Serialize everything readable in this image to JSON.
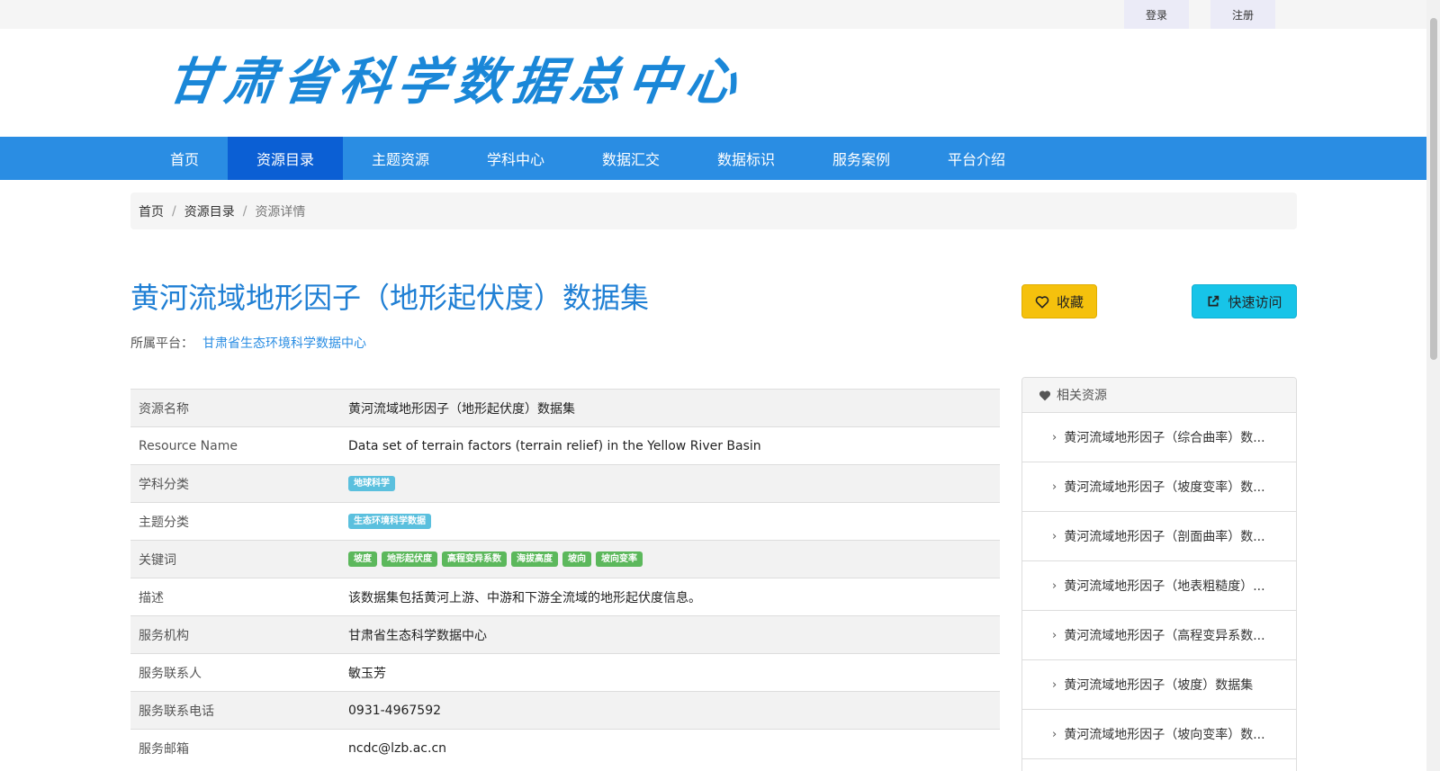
{
  "topbar": {
    "login": "登录",
    "register": "注册"
  },
  "header": {
    "logo_text": "甘肃省科学数据总中心"
  },
  "nav": {
    "items": [
      "首页",
      "资源目录",
      "主题资源",
      "学科中心",
      "数据汇交",
      "数据标识",
      "服务案例",
      "平台介绍"
    ],
    "active": "资源目录"
  },
  "breadcrumb": {
    "home": "首页",
    "catalog": "资源目录",
    "current": "资源详情"
  },
  "resource": {
    "title": "黄河流域地形因子（地形起伏度）数据集",
    "platform_label": "所属平台：",
    "platform_name": "甘肃省生态环境科学数据中心",
    "fav_label": "收藏",
    "visit_label": "快速访问"
  },
  "info": {
    "name_label": "资源名称",
    "name_value": "黄河流域地形因子（地形起伏度）数据集",
    "en_label": "Resource Name",
    "en_value": "Data set of terrain factors (terrain relief) in the Yellow River Basin",
    "subject_label": "学科分类",
    "subject_tag": "地球科学",
    "theme_label": "主题分类",
    "theme_tag": "生态环境科学数据",
    "keywords_label": "关键词",
    "keywords": [
      "坡度",
      "地形起伏度",
      "高程变异系数",
      "海拔高度",
      "坡向",
      "坡向变率"
    ],
    "desc_label": "描述",
    "desc_value": "该数据集包括黄河上游、中游和下游全流域的地形起伏度信息。",
    "org_label": "服务机构",
    "org_value": "甘肃省生态科学数据中心",
    "contact_label": "服务联系人",
    "contact_value": "敏玉芳",
    "phone_label": "服务联系电话",
    "phone_value": "0931-4967592",
    "email_label": "服务邮箱",
    "email_value": "ncdc@lzb.ac.cn"
  },
  "related": {
    "title": "相关资源",
    "items": [
      "黄河流域地形因子（综合曲率）数...",
      "黄河流域地形因子（坡度变率）数...",
      "黄河流域地形因子（剖面曲率）数...",
      "黄河流域地形因子（地表粗糙度）...",
      "黄河流域地形因子（高程变异系数...",
      "黄河流域地形因子（坡度）数据集",
      "黄河流域地形因子（坡向变率）数..."
    ]
  }
}
